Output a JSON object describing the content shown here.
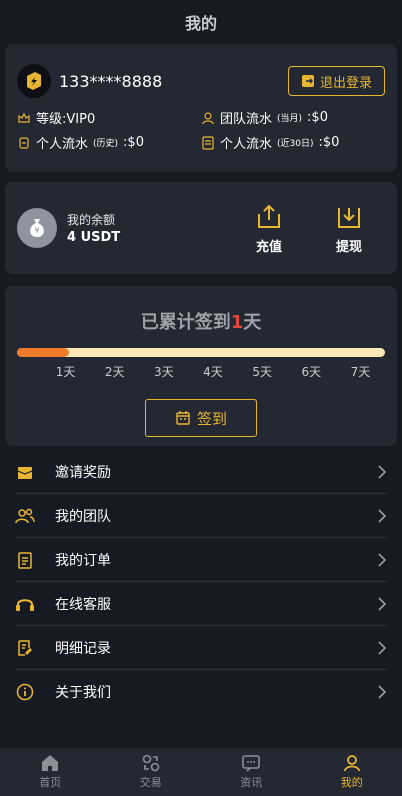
{
  "header": {
    "title": "我的"
  },
  "profile": {
    "phone": "133****8888",
    "logout_label": "退出登录",
    "level_label": "等级:VIP0",
    "team_flow_label": "团队流水",
    "team_flow_note": "(当月)",
    "team_flow_value": ":$0",
    "personal_flow_label": "个人流水",
    "personal_flow_note": "(历史)",
    "personal_flow_value": ":$0",
    "personal30_label": "个人流水",
    "personal30_note": "(近30日)",
    "personal30_value": ":$0"
  },
  "balance": {
    "label": "我的余额",
    "value": "4 USDT",
    "deposit_label": "充值",
    "withdraw_label": "提现"
  },
  "checkin": {
    "prefix": "已累计签到",
    "count": "1",
    "suffix": "天",
    "progress": 0.14,
    "days": [
      "1天",
      "2天",
      "3天",
      "4天",
      "5天",
      "6天",
      "7天"
    ],
    "button_label": "签到"
  },
  "menu": [
    {
      "label": "邀请奖励",
      "icon": "gift-box-icon"
    },
    {
      "label": "我的团队",
      "icon": "team-icon"
    },
    {
      "label": "我的订单",
      "icon": "order-icon"
    },
    {
      "label": "在线客服",
      "icon": "headset-icon"
    },
    {
      "label": "明细记录",
      "icon": "record-icon"
    },
    {
      "label": "关于我们",
      "icon": "info-icon"
    }
  ],
  "tabs": [
    {
      "label": "首页",
      "active": false
    },
    {
      "label": "交易",
      "active": false
    },
    {
      "label": "资讯",
      "active": false
    },
    {
      "label": "我的",
      "active": true
    }
  ],
  "colors": {
    "accent": "#e9b631",
    "background": "#161a22",
    "card": "#242833",
    "progress": "#ef7b2b",
    "highlight": "#e2463c"
  }
}
